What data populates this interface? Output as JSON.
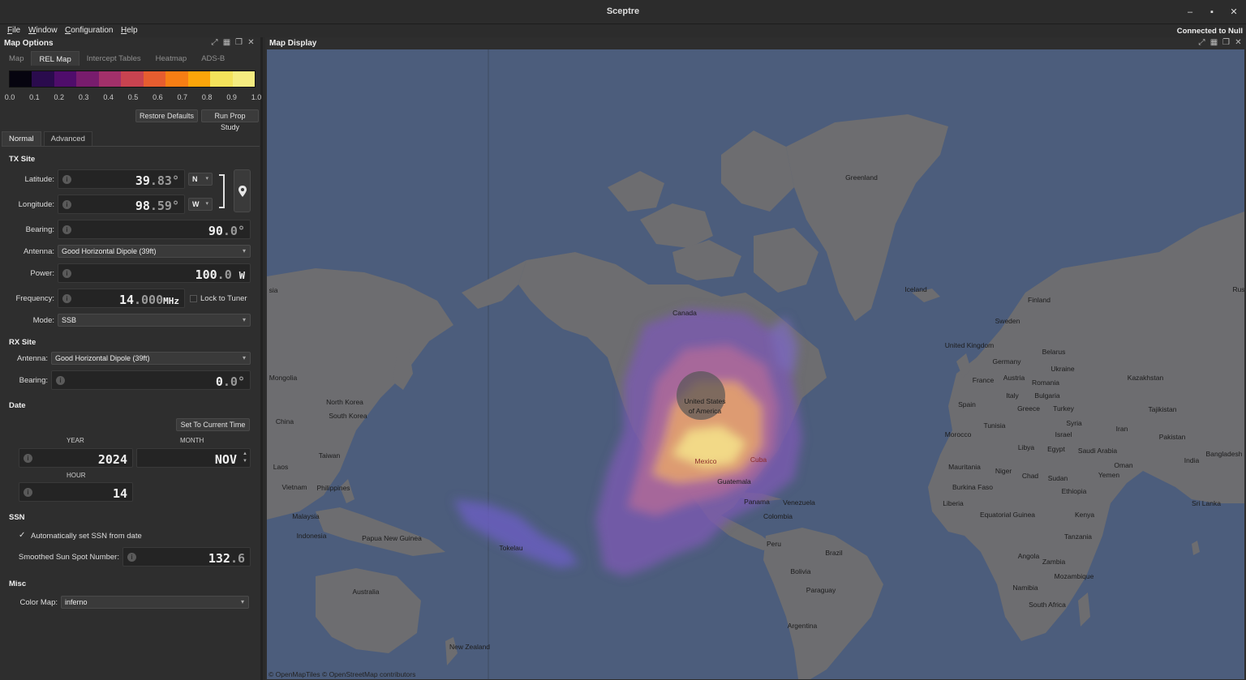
{
  "window": {
    "title": "Sceptre",
    "minimize": "‒",
    "maximize": "▪",
    "close": "✕"
  },
  "menu": [
    "File",
    "Window",
    "Configuration",
    "Help"
  ],
  "status": "Connected to Null",
  "left_dock": {
    "title": "Map Options",
    "tabs": [
      "Map",
      "REL Map",
      "Intercept Tables",
      "Heatmap",
      "ADS-B"
    ],
    "active_tab": "REL Map",
    "colorbar": {
      "colors": [
        "#06040f",
        "#2a0b4d",
        "#4f0d6b",
        "#781c6d",
        "#a2306a",
        "#c84350",
        "#e65d2f",
        "#f67e14",
        "#fca50a",
        "#f3e25b",
        "#f5ec80"
      ],
      "ticks": [
        "0.0",
        "0.1",
        "0.2",
        "0.3",
        "0.4",
        "0.5",
        "0.6",
        "0.7",
        "0.8",
        "0.9",
        "1.0"
      ]
    },
    "restore_defaults": "Restore Defaults",
    "run_prop_study": "Run Prop Study",
    "subtabs": [
      "Normal",
      "Advanced"
    ],
    "tx_site": {
      "heading": "TX Site",
      "latitude_label": "Latitude:",
      "latitude_int": "39",
      "latitude_frac": ".83°",
      "lat_hemi": "N",
      "longitude_label": "Longitude:",
      "longitude_int": "98",
      "longitude_frac": ".59°",
      "lon_hemi": "W",
      "bearing_label": "Bearing:",
      "bearing_int": "90",
      "bearing_frac": ".0°",
      "antenna_label": "Antenna:",
      "antenna_value": "Good Horizontal Dipole (39ft)",
      "power_label": "Power:",
      "power_int": "100",
      "power_frac": ".0",
      "power_unit": "W",
      "frequency_label": "Frequency:",
      "frequency_int": "14",
      "frequency_frac": ".000",
      "frequency_unit": "MHz",
      "lock_to_tuner": "Lock to Tuner",
      "mode_label": "Mode:",
      "mode_value": "SSB"
    },
    "rx_site": {
      "heading": "RX Site",
      "antenna_label": "Antenna:",
      "antenna_value": "Good Horizontal Dipole (39ft)",
      "bearing_label": "Bearing:",
      "bearing_int": "0",
      "bearing_frac": ".0°"
    },
    "date": {
      "heading": "Date",
      "set_current": "Set To Current Time",
      "year_label": "YEAR",
      "year": "2024",
      "month_label": "MONTH",
      "month": "NOV",
      "hour_label": "HOUR",
      "hour": "14"
    },
    "ssn": {
      "heading": "SSN",
      "auto_label": "Automatically set SSN from date",
      "smoothed_label": "Smoothed Sun Spot Number:",
      "ssn_int": "132",
      "ssn_frac": ".6"
    },
    "misc": {
      "heading": "Misc",
      "colormap_label": "Color Map:",
      "colormap_value": "inferno"
    }
  },
  "map": {
    "title": "Map Display",
    "attribution": "© OpenMapTiles © OpenStreetMap contributors",
    "places": {
      "greenland": "Greenland",
      "iceland": "Iceland",
      "canada": "Canada",
      "usa1": "United States",
      "usa2": "of America",
      "mexico": "Mexico",
      "cuba": "Cuba",
      "guatemala": "Guatemala",
      "panama": "Panama",
      "venezuela": "Venezuela",
      "colombia": "Colombia",
      "peru": "Peru",
      "brazil": "Brazil",
      "bolivia": "Bolivia",
      "paraguay": "Paraguay",
      "argentina": "Argentina",
      "finland": "Finland",
      "sweden": "Sweden",
      "uk": "United Kingdom",
      "belarus": "Belarus",
      "germany": "Germany",
      "ukraine": "Ukraine",
      "france": "France",
      "austria": "Austria",
      "romania": "Romania",
      "kazakhstan": "Kazakhstan",
      "italy": "Italy",
      "bulgaria": "Bulgaria",
      "spain": "Spain",
      "greece": "Greece",
      "turkey": "Turkey",
      "tajikistan": "Tajikistan",
      "tunisia": "Tunisia",
      "syria": "Syria",
      "iran": "Iran",
      "morocco": "Morocco",
      "israel": "Israel",
      "pakistan": "Pakistan",
      "libya": "Libya",
      "egypt": "Egypt",
      "saudi": "Saudi Arabia",
      "india": "India",
      "bangladesh": "Bangladesh",
      "mauritania": "Mauritania",
      "niger": "Niger",
      "oman": "Oman",
      "chad": "Chad",
      "sudan": "Sudan",
      "yemen": "Yemen",
      "burkina": "Burkina Faso",
      "ethiopia": "Ethiopia",
      "liberia": "Liberia",
      "eqguinea": "Equatorial Guinea",
      "kenya": "Kenya",
      "srilanka": "Sri Lanka",
      "tanzania": "Tanzania",
      "angola": "Angola",
      "zambia": "Zambia",
      "mozambique": "Mozambique",
      "namibia": "Namibia",
      "southafrica": "South Africa",
      "rus": "Rus",
      "sia": "sia",
      "mongolia": "Mongolia",
      "nkorea": "North Korea",
      "skorea": "South Korea",
      "china": "China",
      "taiwan": "Taiwan",
      "laos": "Laos",
      "vietnam": "Vietnam",
      "philippines": "Philippines",
      "malaysia": "Malaysia",
      "indonesia": "Indonesia",
      "png": "Papua New Guinea",
      "tokelau": "Tokelau",
      "australia": "Australia",
      "nz": "New Zealand"
    }
  }
}
